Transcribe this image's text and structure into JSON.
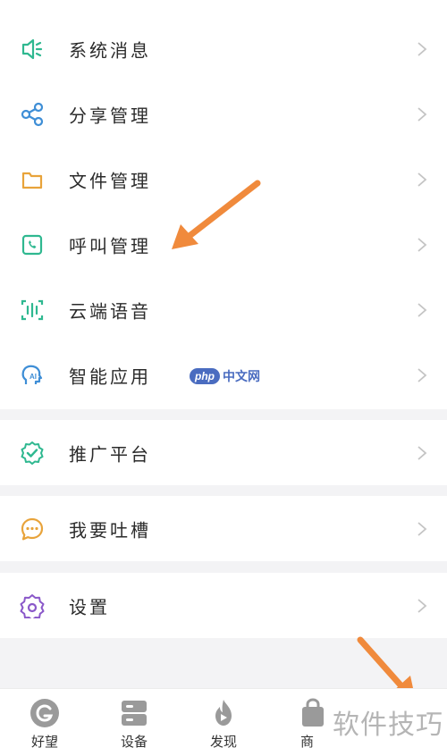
{
  "menu_group_1": [
    {
      "label": "系统消息",
      "icon": "speaker-icon"
    },
    {
      "label": "分享管理",
      "icon": "share-icon"
    },
    {
      "label": "文件管理",
      "icon": "folder-icon"
    },
    {
      "label": "呼叫管理",
      "icon": "phone-icon"
    },
    {
      "label": "云端语音",
      "icon": "voice-wave-icon"
    },
    {
      "label": "智能应用",
      "icon": "ai-head-icon"
    }
  ],
  "menu_group_2": [
    {
      "label": "推广平台",
      "icon": "badge-check-icon"
    }
  ],
  "menu_group_3": [
    {
      "label": "我要吐槽",
      "icon": "chat-bubble-icon"
    }
  ],
  "menu_group_4": [
    {
      "label": "设置",
      "icon": "gear-icon"
    }
  ],
  "tabbar": [
    {
      "label": "好望",
      "icon": "brand-g-icon"
    },
    {
      "label": "设备",
      "icon": "device-icon"
    },
    {
      "label": "发现",
      "icon": "flame-icon"
    },
    {
      "label": "商",
      "icon": "shop-icon"
    }
  ],
  "watermarks": {
    "php_badge": "php",
    "php_text": "中文网",
    "corner_text": "软件技巧"
  },
  "colors": {
    "accent_green": "#2fb890",
    "accent_blue": "#3e8ed6",
    "accent_orange": "#e8a33a",
    "accent_purple": "#8a58c9",
    "annotation_arrow": "#f08a3c"
  }
}
